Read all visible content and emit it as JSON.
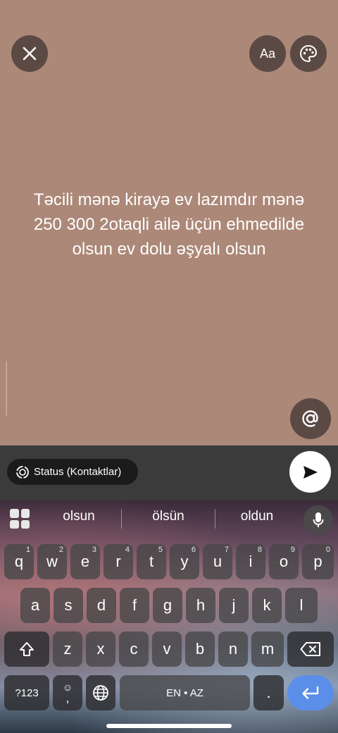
{
  "status_editor": {
    "text": "Təcili mənə kirayə ev lazımdır mənə 250 300 2otaqli ailə üçün ehmedilde olsun ev dolu əşyalı olsun",
    "font_button_label": "Aa",
    "background_color": "#ac8878",
    "close_icon": "close-icon",
    "palette_icon": "palette-icon",
    "mention_icon": "at-sign-icon"
  },
  "bottom_bar": {
    "audience_label": "Status (Kontaktlar)",
    "audience_icon": "status-ring-icon",
    "send_icon": "send-icon"
  },
  "keyboard": {
    "suggestions": [
      "olsun",
      "ölsün",
      "oldun"
    ],
    "row1": [
      {
        "label": "q",
        "hint": "1"
      },
      {
        "label": "w",
        "hint": "2"
      },
      {
        "label": "e",
        "hint": "3"
      },
      {
        "label": "r",
        "hint": "4"
      },
      {
        "label": "t",
        "hint": "5"
      },
      {
        "label": "y",
        "hint": "6"
      },
      {
        "label": "u",
        "hint": "7"
      },
      {
        "label": "i",
        "hint": "8"
      },
      {
        "label": "o",
        "hint": "9"
      },
      {
        "label": "p",
        "hint": "0"
      }
    ],
    "row2": [
      "a",
      "s",
      "d",
      "f",
      "g",
      "h",
      "j",
      "k",
      "l"
    ],
    "row3": [
      "z",
      "x",
      "c",
      "v",
      "b",
      "n",
      "m"
    ],
    "symbols_label": "?123",
    "emoji_label": "☺",
    "comma_label": ",",
    "space_label": "EN • AZ",
    "period_label": ".",
    "shift_icon": "shift-icon",
    "backspace_icon": "backspace-icon",
    "globe_icon": "globe-icon",
    "enter_icon": "enter-icon",
    "mic_icon": "microphone-icon",
    "apps_icon": "apps-grid-icon"
  }
}
